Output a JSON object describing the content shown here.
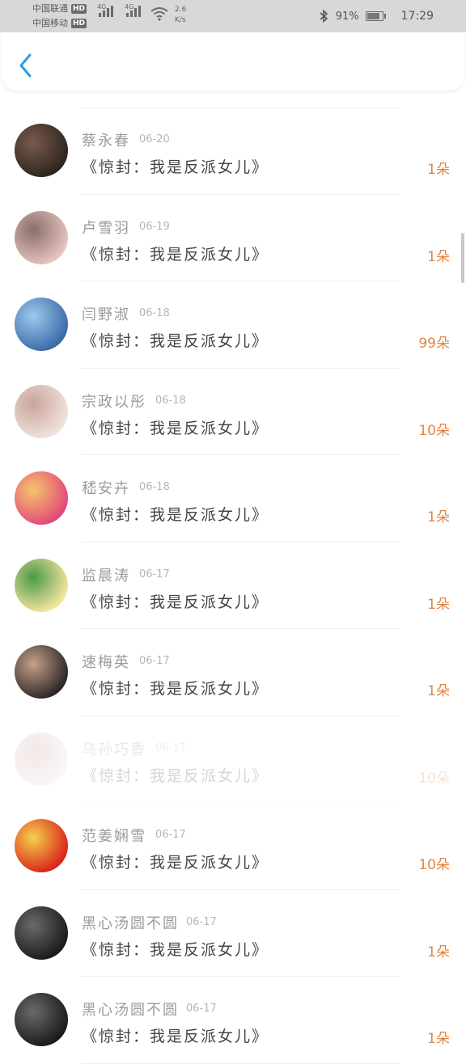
{
  "status_bar": {
    "carrier1": "中国联通",
    "carrier2": "中国移动",
    "hd_label": "HD",
    "network1": "4G",
    "network2": "4G",
    "speed_value": "2.6",
    "speed_unit": "K/s",
    "battery_percent": "91%",
    "battery_level": 0.91,
    "time": "17:29"
  },
  "header": {
    "back_icon": "chevron-left-icon"
  },
  "records": [
    {
      "name": "蔡永春",
      "date": "06-20",
      "title": "《惊封：我是反派女儿》",
      "count": "1朵",
      "avatar_colors": [
        "#2b2420",
        "#7a5a4a"
      ]
    },
    {
      "name": "卢雪羽",
      "date": "06-19",
      "title": "《惊封：我是反派女儿》",
      "count": "1朵",
      "avatar_colors": [
        "#e8c4c0",
        "#8a6e6a"
      ]
    },
    {
      "name": "闫野淑",
      "date": "06-18",
      "title": "《惊封：我是反派女儿》",
      "count": "99朵",
      "avatar_colors": [
        "#3a6aa8",
        "#9ec8ea"
      ]
    },
    {
      "name": "宗政以彤",
      "date": "06-18",
      "title": "《惊封：我是反派女儿》",
      "count": "10朵",
      "avatar_colors": [
        "#f1e2dc",
        "#c9a59a"
      ]
    },
    {
      "name": "嵇安卉",
      "date": "06-18",
      "title": "《惊封：我是反派女儿》",
      "count": "1朵",
      "avatar_colors": [
        "#e0487a",
        "#f6c46a"
      ]
    },
    {
      "name": "监晨涛",
      "date": "06-17",
      "title": "《惊封：我是反派女儿》",
      "count": "1朵",
      "avatar_colors": [
        "#f6e6a0",
        "#4b9a4a"
      ]
    },
    {
      "name": "速梅英",
      "date": "06-17",
      "title": "《惊封：我是反派女儿》",
      "count": "1朵",
      "avatar_colors": [
        "#2a2624",
        "#c7a08a"
      ]
    },
    {
      "name": "乌孙巧香",
      "date": "06-17",
      "title": "《惊封：我是反派女儿》",
      "count": "10朵",
      "avatar_colors": [
        "#f3d6d6",
        "#c49a9a"
      ],
      "faded": true
    },
    {
      "name": "范姜娴雪",
      "date": "06-17",
      "title": "《惊封：我是反派女儿》",
      "count": "10朵",
      "avatar_colors": [
        "#d8211a",
        "#f6d24a"
      ]
    },
    {
      "name": "黑心汤圆不圆",
      "date": "06-17",
      "title": "《惊封：我是反派女儿》",
      "count": "1朵",
      "avatar_colors": [
        "#1a1a1a",
        "#6a6a6a"
      ]
    },
    {
      "name": "黑心汤圆不圆",
      "date": "06-17",
      "title": "《惊封：我是反派女儿》",
      "count": "1朵",
      "avatar_colors": [
        "#1a1a1a",
        "#6a6a6a"
      ]
    }
  ]
}
